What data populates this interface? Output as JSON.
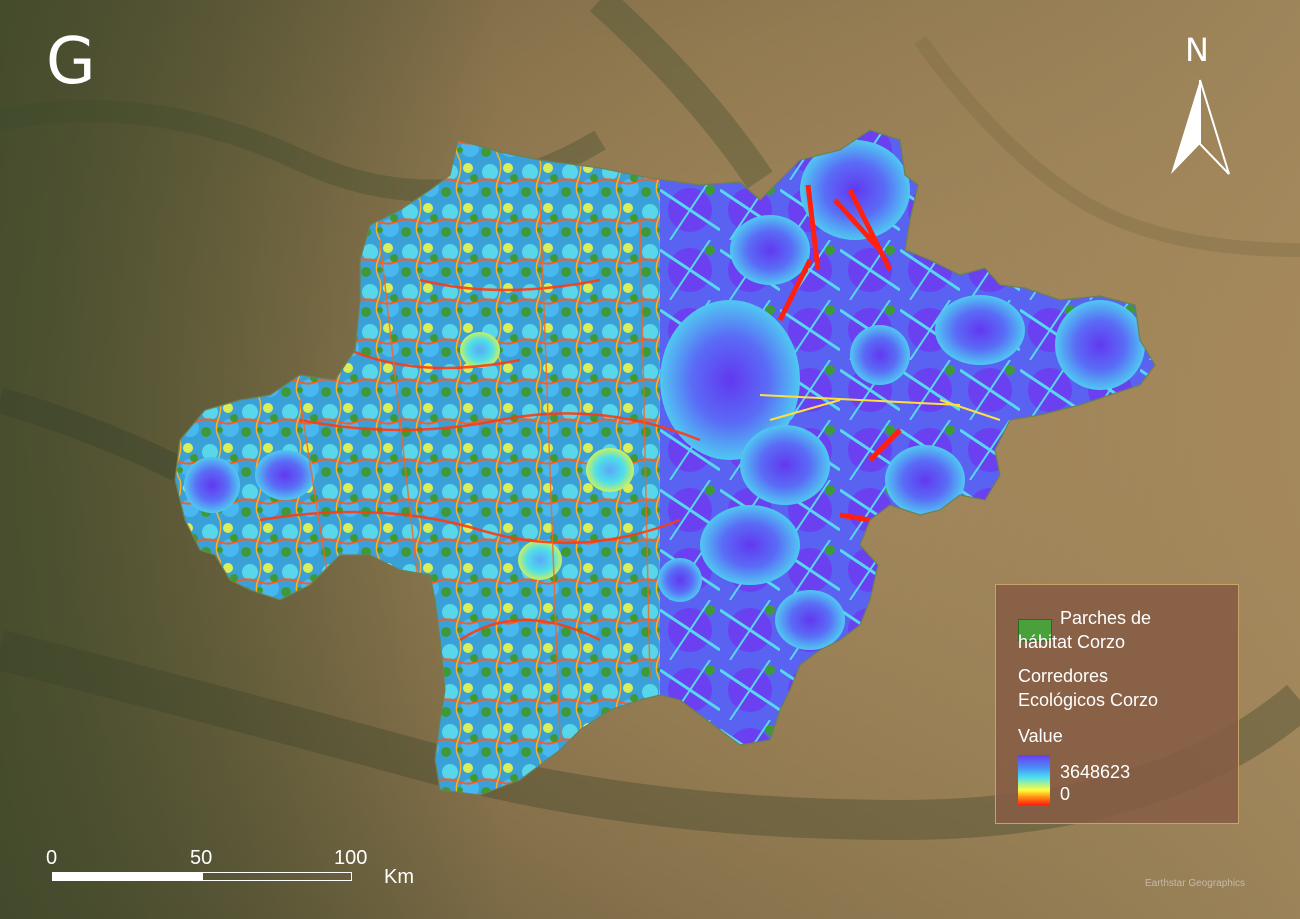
{
  "panel_label": "G",
  "north_arrow": {
    "letter": "N",
    "icon": "north-arrow-icon"
  },
  "legend": {
    "patch_label_line1": "Parches de",
    "patch_label_line2": "hábitat Corzo",
    "patch_color": "#4aa03a",
    "corridor_title_line1": "Corredores",
    "corridor_title_line2": "Ecológicos Corzo",
    "value_label": "Value",
    "max_value": "3648623",
    "min_value": "0",
    "ramp_colors": [
      "#6a3cf0",
      "#4a8cf8",
      "#4ae0f0",
      "#ffff40",
      "#ff8a10",
      "#ff1e10"
    ]
  },
  "scale_bar": {
    "ticks": [
      "0",
      "50",
      "100"
    ],
    "unit": "Km"
  },
  "credit": "Earthstar Geographics"
}
